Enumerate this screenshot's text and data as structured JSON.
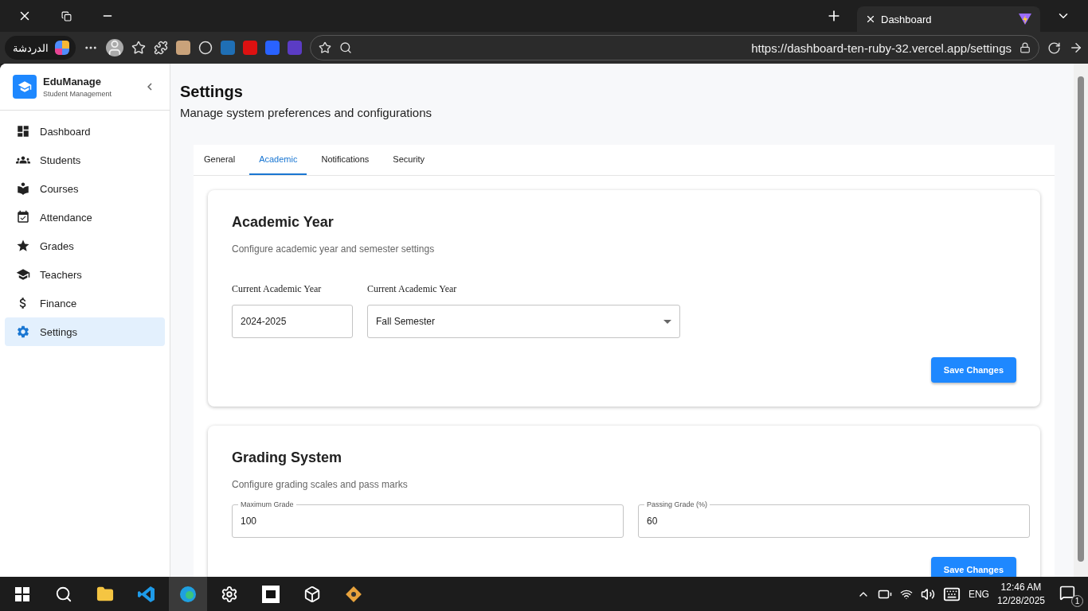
{
  "browser": {
    "tab_title": "Dashboard",
    "chat_label": "الدردشة",
    "address": "https://dashboard-ten-ruby-32.vercel.app/settings"
  },
  "sidebar": {
    "brand": "EduManage",
    "subtitle": "Student Management",
    "items": [
      {
        "label": "Dashboard",
        "selected": false
      },
      {
        "label": "Students",
        "selected": false
      },
      {
        "label": "Courses",
        "selected": false
      },
      {
        "label": "Attendance",
        "selected": false
      },
      {
        "label": "Grades",
        "selected": false
      },
      {
        "label": "Teachers",
        "selected": false
      },
      {
        "label": "Finance",
        "selected": false
      },
      {
        "label": "Settings",
        "selected": true
      }
    ]
  },
  "page": {
    "title": "Settings",
    "subtitle": "Manage system preferences and configurations"
  },
  "tabs": [
    {
      "label": "General",
      "selected": false
    },
    {
      "label": "Academic",
      "selected": true
    },
    {
      "label": "Notifications",
      "selected": false
    },
    {
      "label": "Security",
      "selected": false
    }
  ],
  "sections": [
    {
      "title": "Academic Year",
      "description": "Configure academic year and semester settings",
      "button": "Save Changes",
      "fields": [
        {
          "kind": "text",
          "label": "Current Academic Year",
          "value": "2024-2025"
        },
        {
          "kind": "select",
          "label": "Current Academic Year",
          "value": "Fall Semester"
        }
      ]
    },
    {
      "title": "Grading System",
      "description": "Configure grading scales and pass marks",
      "button": "Save Changes",
      "fields": [
        {
          "kind": "outlined",
          "label": "Maximum Grade",
          "value": "100"
        },
        {
          "kind": "outlined",
          "label": "Passing Grade (%)",
          "value": "60"
        }
      ]
    }
  ],
  "taskbar": {
    "language": "ENG",
    "time": "12:46 AM",
    "date": "12/28/2025",
    "notifications": "1"
  }
}
